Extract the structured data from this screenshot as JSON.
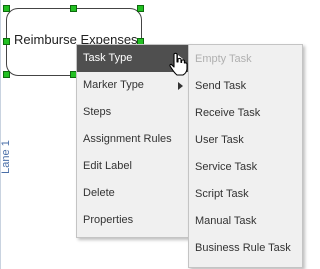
{
  "canvas": {
    "lane_label": "Lane 1",
    "task_label": "Reimburse Expenses"
  },
  "context_menu": {
    "items": [
      {
        "label": "Task Type",
        "has_submenu": true,
        "active": true
      },
      {
        "label": "Marker Type",
        "has_submenu": true
      },
      {
        "label": "Steps"
      },
      {
        "label": "Assignment Rules"
      },
      {
        "label": "Edit Label"
      },
      {
        "label": "Delete"
      },
      {
        "label": "Properties"
      }
    ]
  },
  "submenu": {
    "items": [
      {
        "label": "Empty Task",
        "disabled": true
      },
      {
        "label": "Send Task"
      },
      {
        "label": "Receive Task"
      },
      {
        "label": "User Task"
      },
      {
        "label": "Service Task"
      },
      {
        "label": "Script Task"
      },
      {
        "label": "Manual Task"
      },
      {
        "label": "Business Rule Task"
      }
    ]
  },
  "colors": {
    "menu_bg": "#f0f0f0",
    "active_item_bg": "#4f4f4f",
    "handle_green": "#22c022",
    "lane_label": "#4a6fa8"
  },
  "icons": {
    "cursor": "hand-pointer-icon"
  }
}
